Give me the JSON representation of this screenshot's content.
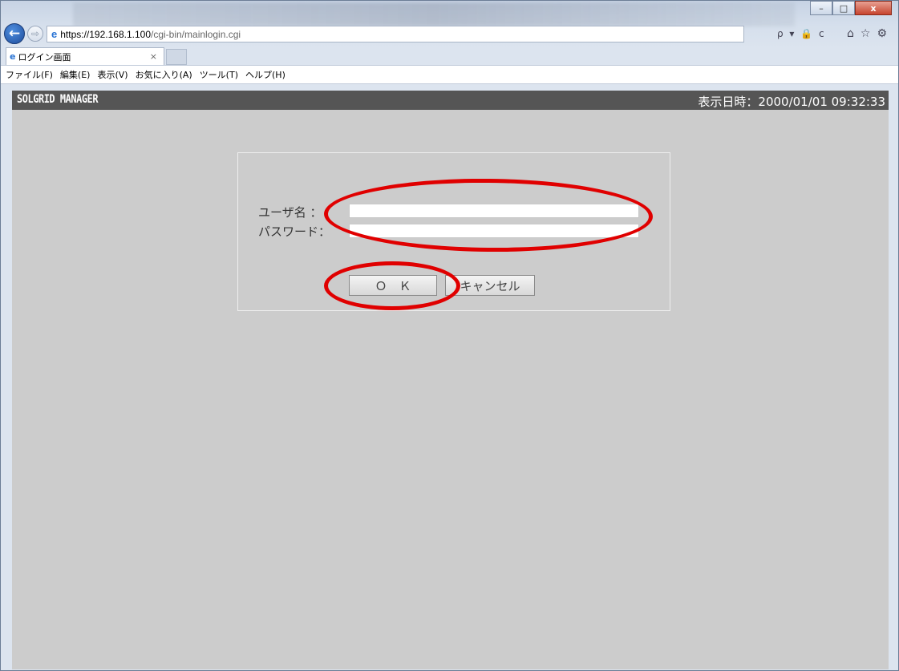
{
  "browser": {
    "url_scheme_host": "https://192.168.1.100",
    "url_path": "/cgi-bin/mainlogin.cgi",
    "tab_title": "ログイン画面",
    "tab_close": "×",
    "window_minimize": "–",
    "window_maximize": "□",
    "window_close": "x",
    "address_tools": "ρ ▾ 🔒 c",
    "menu": [
      "ファイル(F)",
      "編集(E)",
      "表示(V)",
      "お気に入り(A)",
      "ツール(T)",
      "ヘルプ(H)"
    ]
  },
  "header": {
    "title": "SOLGRID MANAGER",
    "datetime_label": "表示日時：2000/01/01 09:32:33"
  },
  "login": {
    "username_label": "ユーザ名 ：",
    "password_label": "パスワード：",
    "username_value": "",
    "password_value": "",
    "ok_label": "Ｏ　Ｋ",
    "cancel_label": "キャンセル"
  },
  "colors": {
    "page_background": "#cccccc",
    "header_background": "#555555",
    "annotation": "#e00000"
  }
}
